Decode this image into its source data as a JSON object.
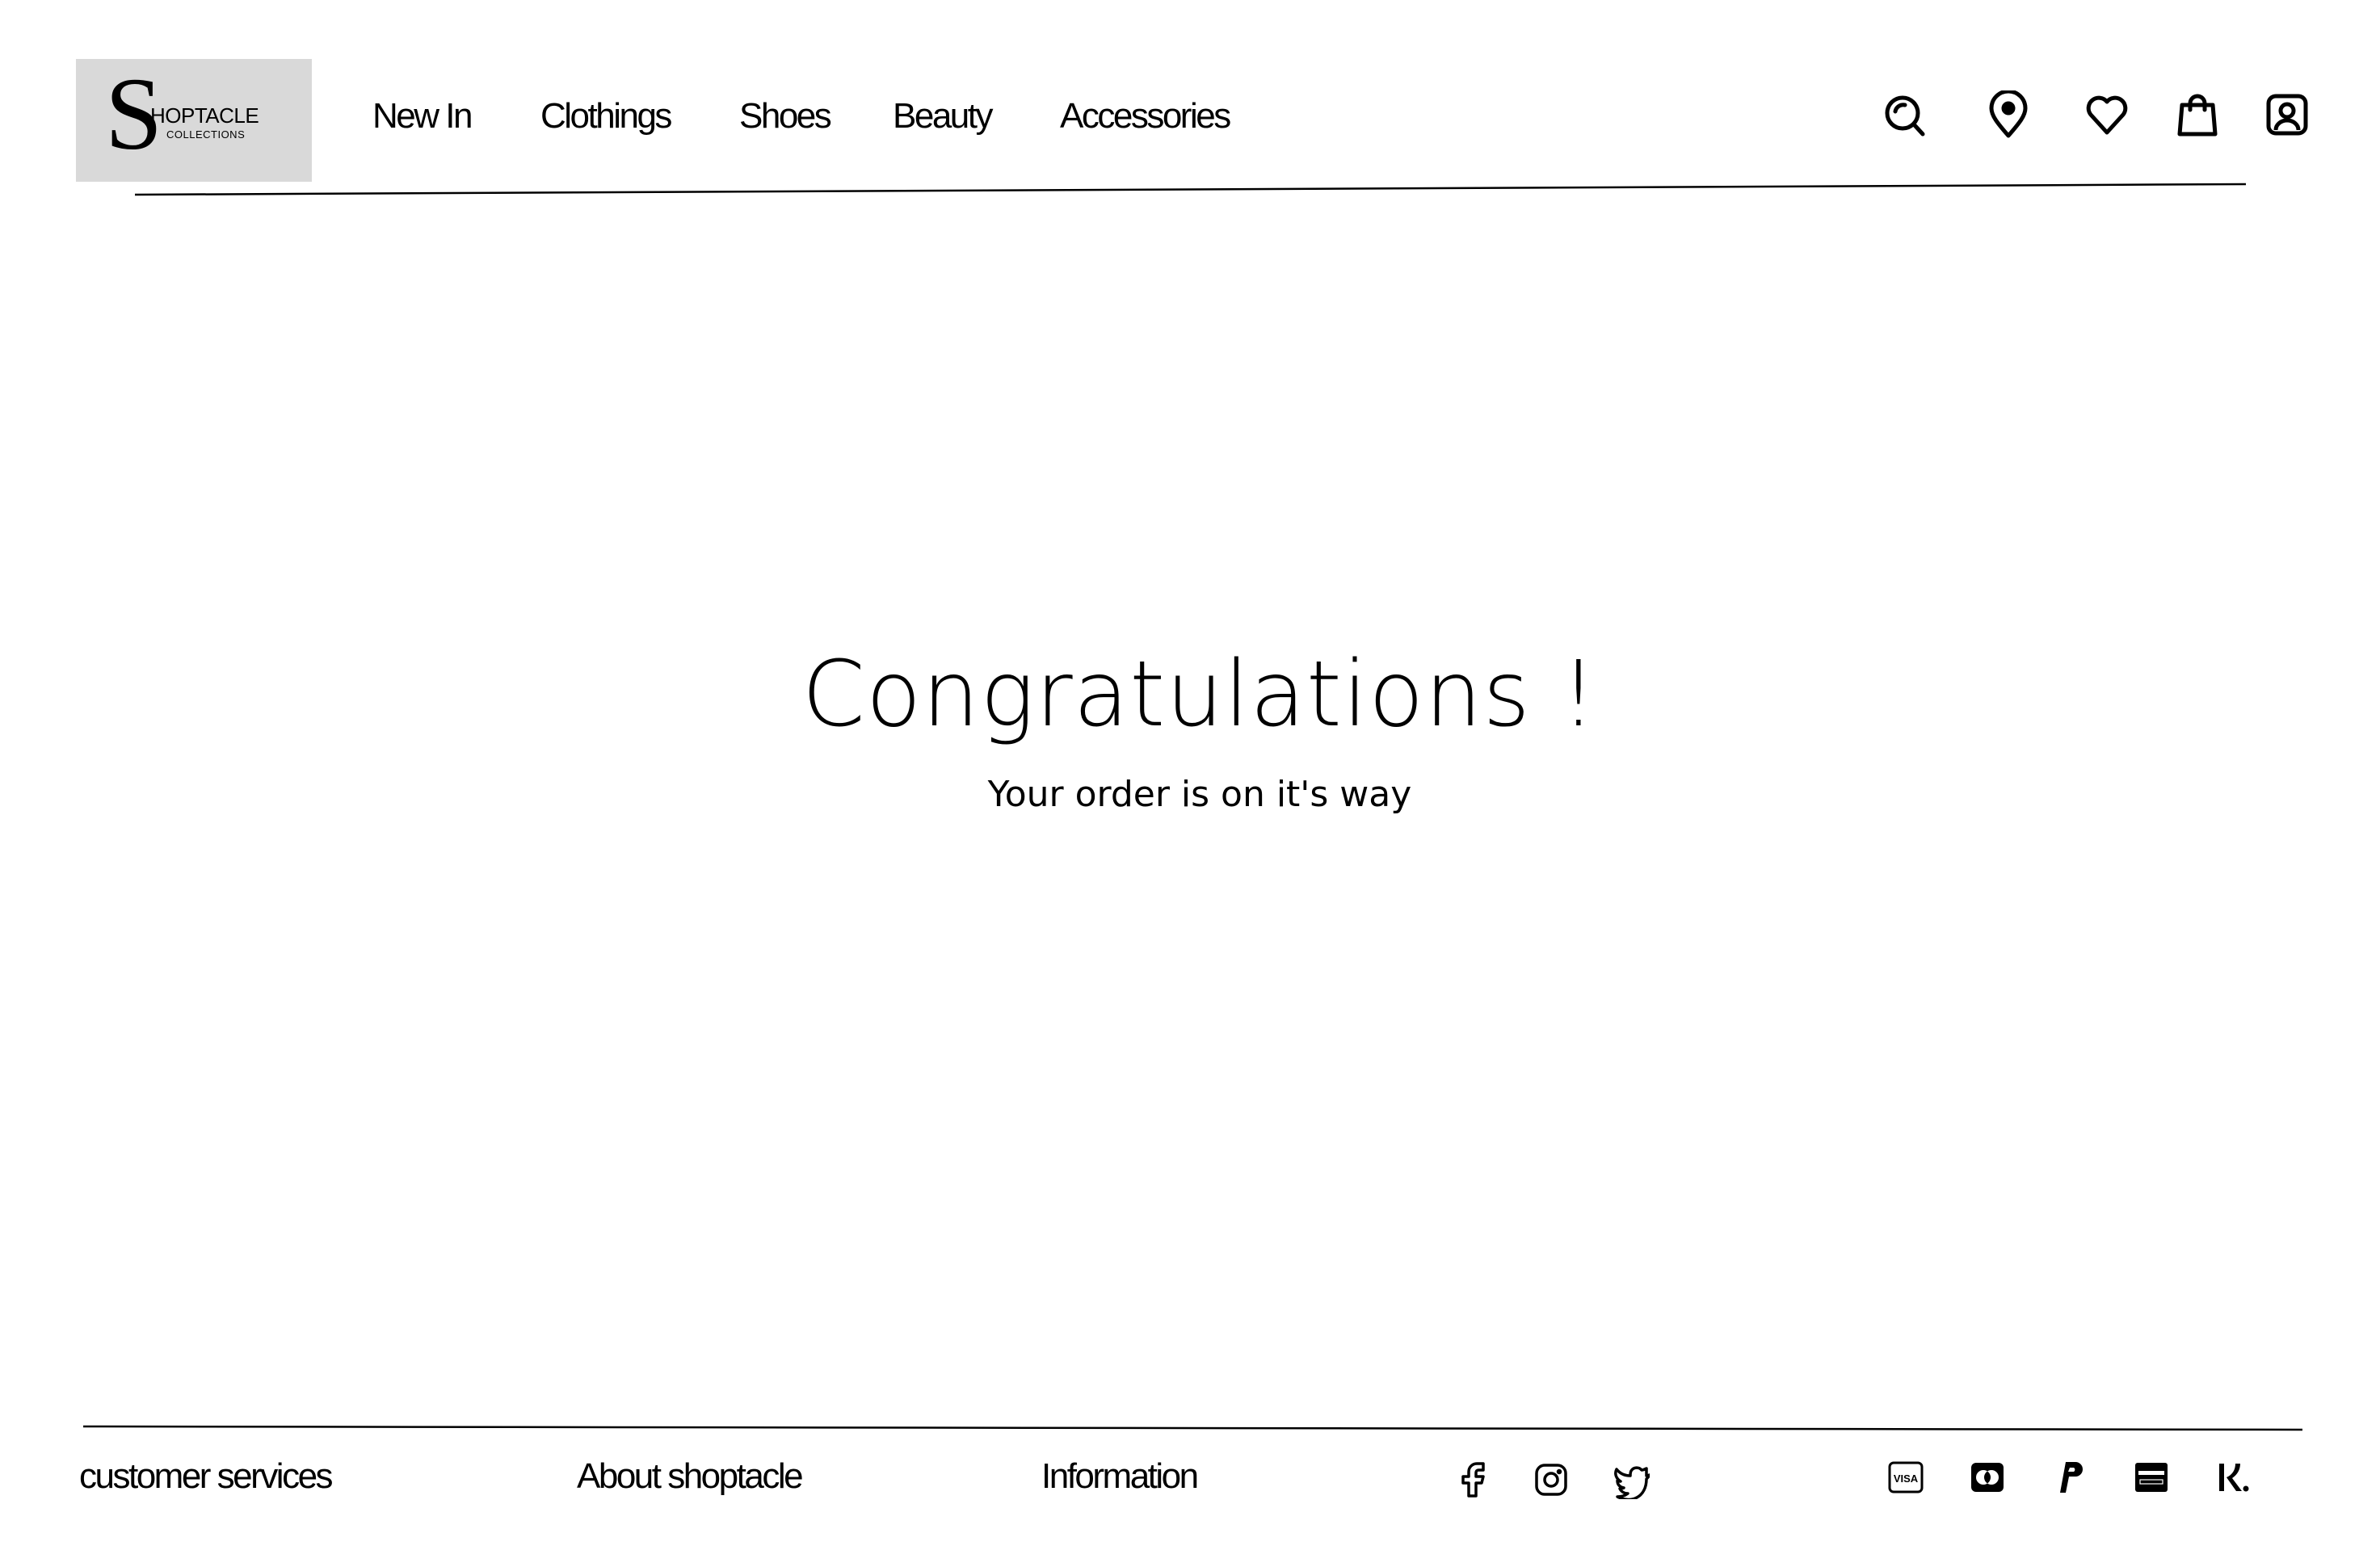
{
  "brand": {
    "logo_letter": "S",
    "logo_word": "HOPTACLE",
    "logo_sub": "COLLECTIONS"
  },
  "nav": {
    "items": [
      {
        "label": "New In"
      },
      {
        "label": "Clothings"
      },
      {
        "label": "Shoes"
      },
      {
        "label": "Beauty"
      },
      {
        "label": "Accessories"
      }
    ]
  },
  "header_icons": [
    "search-icon",
    "location-pin-icon",
    "heart-icon",
    "shopping-bag-icon",
    "account-icon"
  ],
  "main": {
    "title": "Congratulations !",
    "subtitle": "Your order is on it's way"
  },
  "footer": {
    "links": [
      {
        "label": "customer services"
      },
      {
        "label": "About shoptacle"
      },
      {
        "label": "Information"
      }
    ],
    "social_icons": [
      "facebook-icon",
      "instagram-icon",
      "twitter-icon"
    ],
    "payment_icons": [
      "visa-icon",
      "mastercard-icon",
      "paypal-icon",
      "amex-icon",
      "klarna-icon"
    ]
  },
  "colors": {
    "background": "#ffffff",
    "text": "#000000",
    "logo_bg": "#d9d9d9"
  }
}
